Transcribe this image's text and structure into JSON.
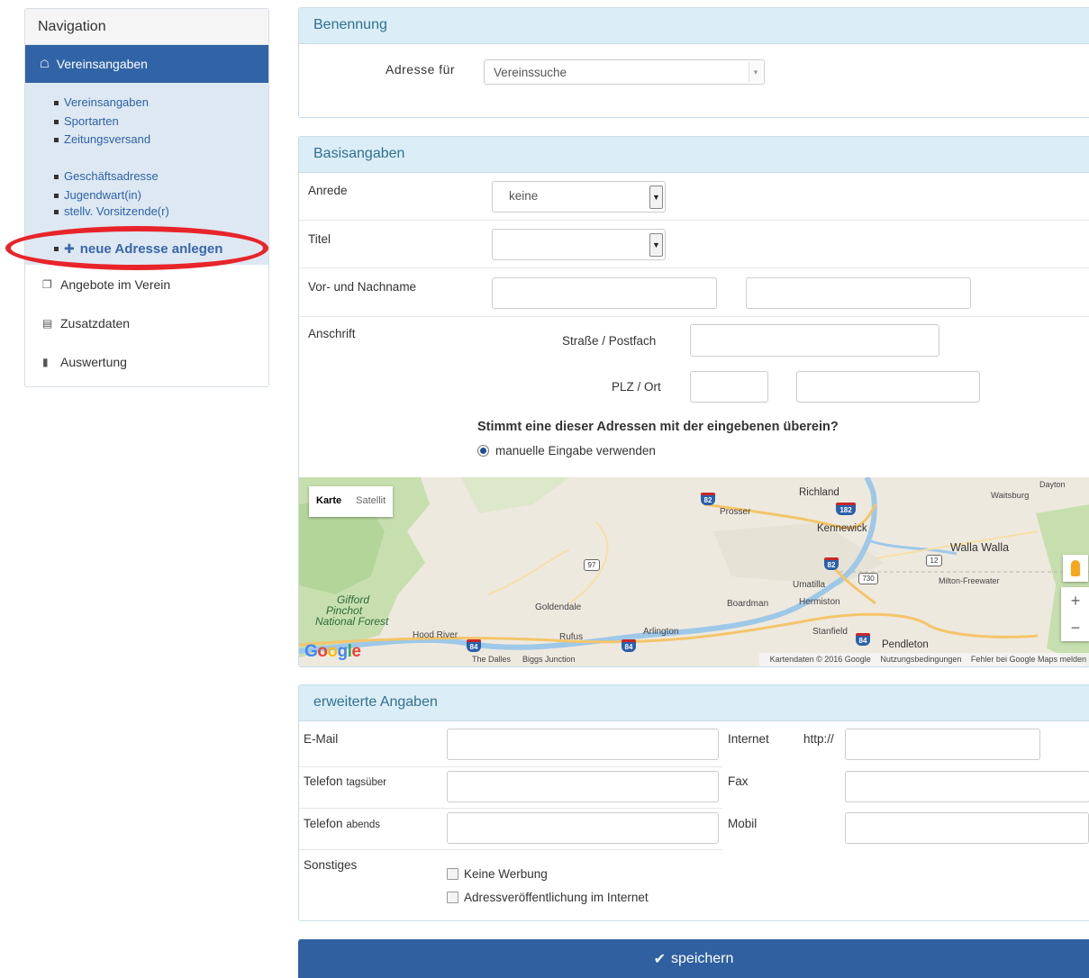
{
  "sidebar": {
    "heading": "Navigation",
    "active_item": "Vereinsangaben",
    "sub_items": [
      "Vereinsangaben",
      "Sportarten",
      "Zeitungsversand"
    ],
    "address_items": [
      "Geschäftsadresse",
      "Jugendwart(in)",
      "stellv. Vorsitzende(r)"
    ],
    "new_address": "neue Adresse anlegen",
    "items": [
      {
        "label": "Angebote im Verein",
        "icon": "puzzle-icon"
      },
      {
        "label": "Zusatzdaten",
        "icon": "document-icon"
      },
      {
        "label": "Auswertung",
        "icon": "bar-chart-icon"
      }
    ],
    "highlight_color": "#e8242a"
  },
  "benennung": {
    "title": "Benennung",
    "label": "Adresse für",
    "value": "Vereinssuche"
  },
  "basis": {
    "title": "Basisangaben",
    "anrede_label": "Anrede",
    "anrede_value": "keine",
    "titel_label": "Titel",
    "titel_value": "",
    "name_label": "Vor- und Nachname",
    "anschrift_label": "Anschrift",
    "strasse_label": "Straße / Postfach",
    "plz_label": "PLZ / Ort",
    "question": "Stimmt eine dieser Adressen mit der eingebenen überein?",
    "radio_label": "manuelle Eingabe verwenden"
  },
  "map": {
    "type_map": "Karte",
    "type_satellite": "Satellit",
    "logo": "Google",
    "footer": [
      "Kartendaten © 2016 Google",
      "Nutzungsbedingungen",
      "Fehler bei Google Maps melden"
    ],
    "zoom_in": "+",
    "zoom_out": "−",
    "places": {
      "richland": "Richland",
      "dayton": "Dayton",
      "waitsburg": "Waitsburg",
      "prosser": "Prosser",
      "kennewick": "Kennewick",
      "walla_walla": "Walla Walla",
      "umatilla": "Umatilla",
      "milton": "Milton-Freewater",
      "gifford": "Gifford",
      "pinchot": "Pinchot",
      "national_forest": "National Forest",
      "goldendale": "Goldendale",
      "boardman": "Boardman",
      "hermiston": "Hermiston",
      "hood_river": "Hood River",
      "rufus": "Rufus",
      "arlington": "Arlington",
      "stanfield": "Stanfield",
      "pendleton": "Pendleton",
      "the_dalles": "The Dalles",
      "biggs": "Biggs Junction"
    },
    "routes": {
      "i82": "82",
      "i182": "182",
      "i84": "84",
      "us97": "97",
      "us730": "730",
      "us12": "12"
    }
  },
  "erweitert": {
    "title": "erweiterte Angaben",
    "email_label": "E-Mail",
    "internet_label": "Internet",
    "internet_prefix": "http://",
    "tel_day_label": "Telefon",
    "tel_day_suffix": "tagsüber",
    "fax_label": "Fax",
    "tel_eve_label": "Telefon",
    "tel_eve_suffix": "abends",
    "mobil_label": "Mobil",
    "sonstiges_label": "Sonstiges",
    "cb_werbung": "Keine Werbung",
    "cb_internet": "Adressveröffentlichung im Internet"
  },
  "save_label": "speichern",
  "colors": {
    "primary": "#30609f",
    "panel_header": "#dbeef7",
    "panel_header_text": "#31708f"
  }
}
